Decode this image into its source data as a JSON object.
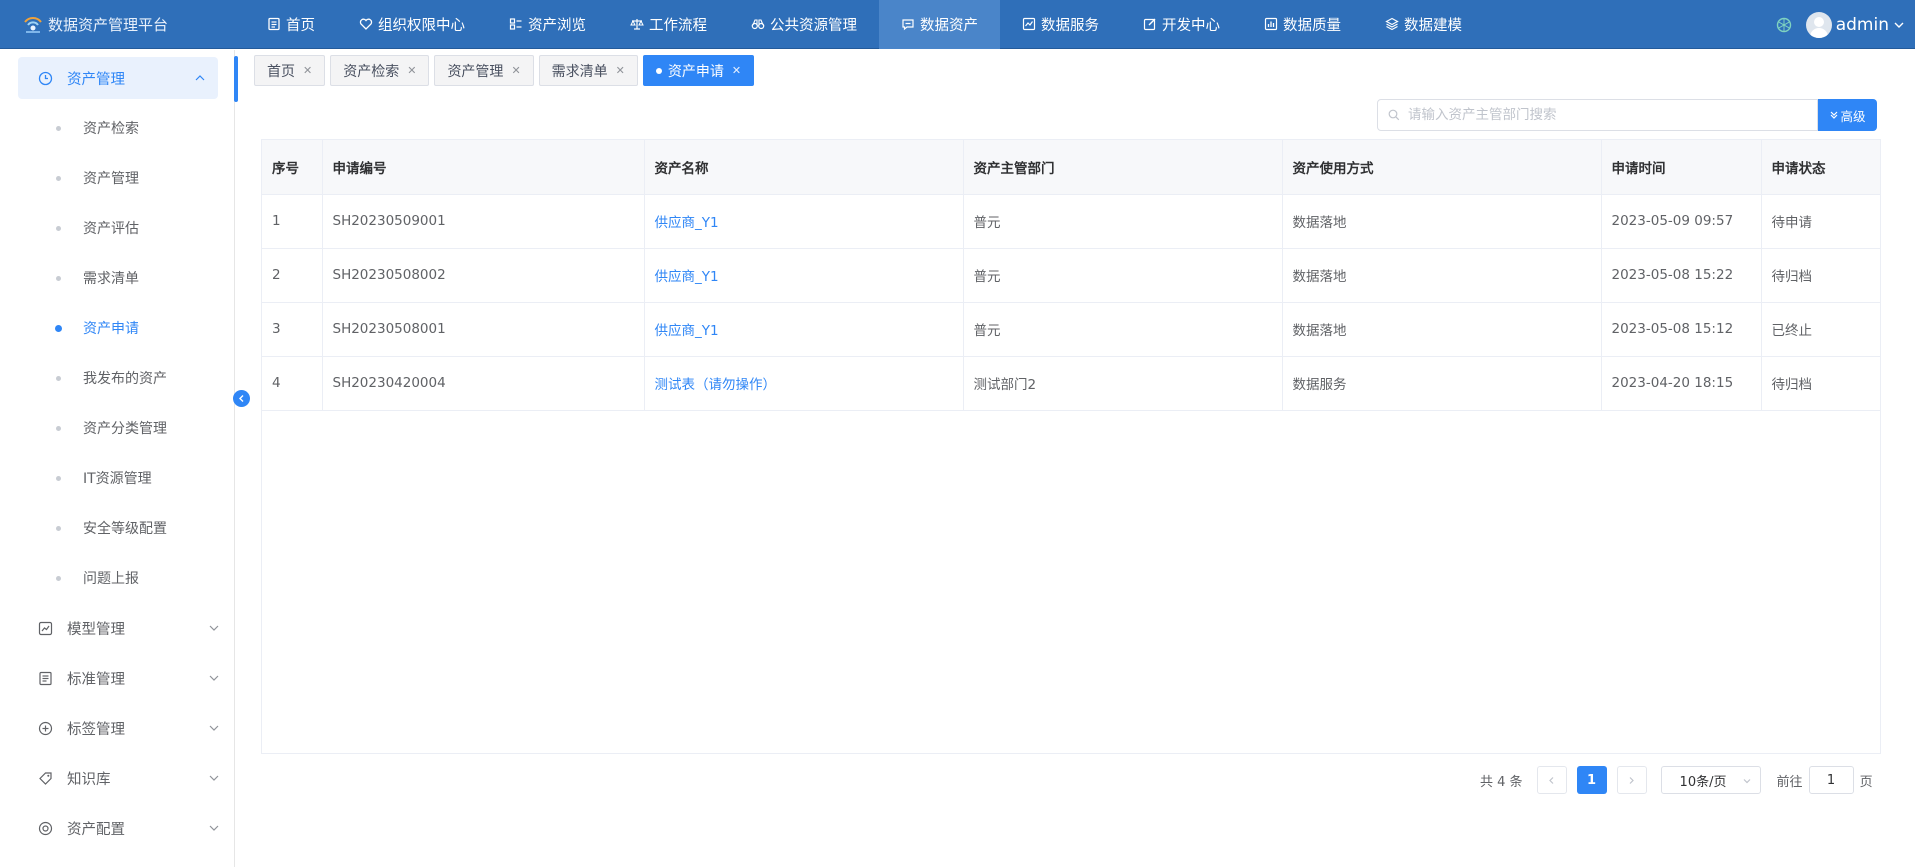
{
  "app": {
    "title": "数据资产管理平台"
  },
  "topnav": [
    {
      "label": "首页",
      "icon": "document-icon"
    },
    {
      "label": "组织权限中心",
      "icon": "heart-shield-icon"
    },
    {
      "label": "资产浏览",
      "icon": "grid-list-icon"
    },
    {
      "label": "工作流程",
      "icon": "scale-icon"
    },
    {
      "label": "公共资源管理",
      "icon": "binoculars-icon"
    },
    {
      "label": "数据资产",
      "icon": "chat-icon",
      "active": true
    },
    {
      "label": "数据服务",
      "icon": "chart-icon"
    },
    {
      "label": "开发中心",
      "icon": "edit-icon"
    },
    {
      "label": "数据质量",
      "icon": "bar-chart-icon"
    },
    {
      "label": "数据建模",
      "icon": "layers-icon"
    }
  ],
  "user": {
    "name": "admin"
  },
  "sidebar": {
    "open_group": {
      "label": "资产管理",
      "icon": "clock-icon"
    },
    "sub_items": [
      {
        "label": "资产检索"
      },
      {
        "label": "资产管理"
      },
      {
        "label": "资产评估"
      },
      {
        "label": "需求清单"
      },
      {
        "label": "资产申请",
        "active": true
      },
      {
        "label": "我发布的资产"
      },
      {
        "label": "资产分类管理"
      },
      {
        "label": "IT资源管理"
      },
      {
        "label": "安全等级配置"
      },
      {
        "label": "问题上报"
      }
    ],
    "groups": [
      {
        "label": "模型管理",
        "icon": "trend-icon"
      },
      {
        "label": "标准管理",
        "icon": "document-list-icon"
      },
      {
        "label": "标签管理",
        "icon": "plus-circle-icon"
      },
      {
        "label": "知识库",
        "icon": "tag-icon"
      },
      {
        "label": "资产配置",
        "icon": "settings-ring-icon"
      }
    ]
  },
  "tabs": [
    {
      "label": "首页"
    },
    {
      "label": "资产检索"
    },
    {
      "label": "资产管理"
    },
    {
      "label": "需求清单"
    },
    {
      "label": "资产申请",
      "active": true
    }
  ],
  "search": {
    "placeholder": "请输入资产主管部门搜索",
    "value": "",
    "advanced_label": "高级"
  },
  "table": {
    "columns": [
      "序号",
      "申请编号",
      "资产名称",
      "资产主管部门",
      "资产使用方式",
      "申请时间",
      "申请状态"
    ],
    "rows": [
      [
        "1",
        "SH20230509001",
        "供应商_Y1",
        "普元",
        "数据落地",
        "2023-05-09 09:57",
        "待申请"
      ],
      [
        "2",
        "SH20230508002",
        "供应商_Y1",
        "普元",
        "数据落地",
        "2023-05-08 15:22",
        "待归档"
      ],
      [
        "3",
        "SH20230508001",
        "供应商_Y1",
        "普元",
        "数据落地",
        "2023-05-08 15:12",
        "已终止"
      ],
      [
        "4",
        "SH20230420004",
        "测试表（请勿操作）",
        "测试部门2",
        "数据服务",
        "2023-04-20 18:15",
        "待归档"
      ]
    ]
  },
  "pagination": {
    "total_label": "共 4 条",
    "current_page": "1",
    "page_size": "10条/页",
    "goto_prefix": "前往",
    "goto_value": "1",
    "goto_suffix": "页"
  },
  "colors": {
    "topbar": "#2f6fb9",
    "accent": "#2f86f6",
    "active_nav": "#4a85c9"
  }
}
